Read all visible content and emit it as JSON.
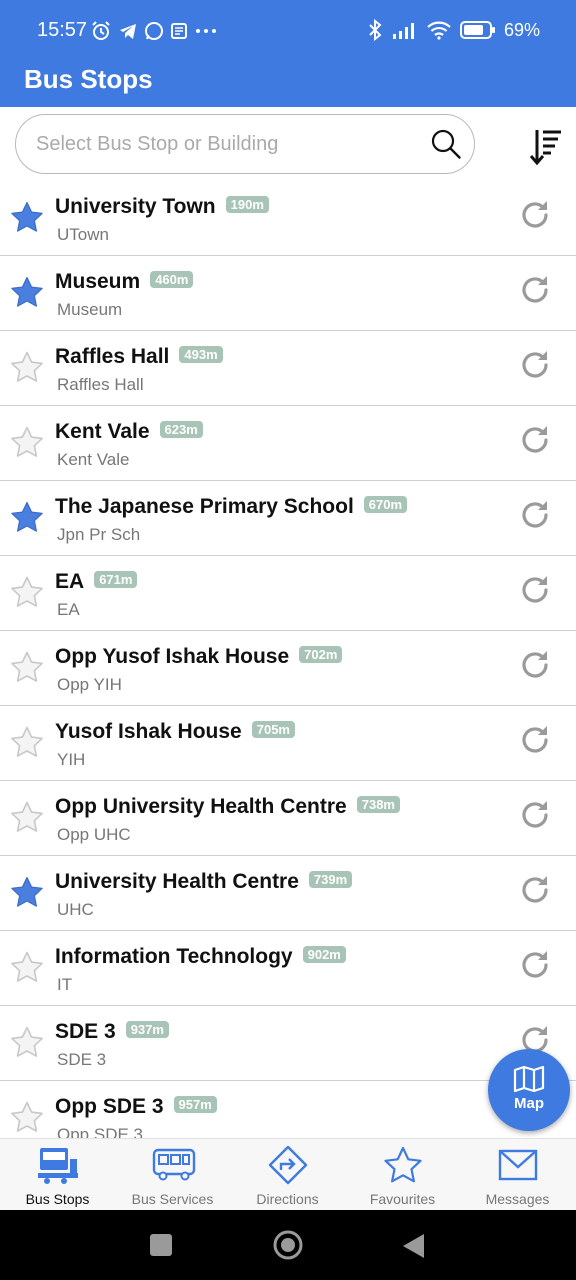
{
  "status_bar": {
    "time": "15:57",
    "battery": "69%"
  },
  "header": {
    "title": "Bus Stops"
  },
  "search": {
    "placeholder": "Select Bus Stop or Building"
  },
  "stops": [
    {
      "name": "University Town",
      "distance": "190m",
      "code": "UTown",
      "favourite": true
    },
    {
      "name": "Museum",
      "distance": "460m",
      "code": "Museum",
      "favourite": true
    },
    {
      "name": "Raffles Hall",
      "distance": "493m",
      "code": "Raffles Hall",
      "favourite": false
    },
    {
      "name": "Kent Vale",
      "distance": "623m",
      "code": "Kent Vale",
      "favourite": false
    },
    {
      "name": "The Japanese Primary School",
      "distance": "670m",
      "code": "Jpn Pr Sch",
      "favourite": true
    },
    {
      "name": "EA",
      "distance": "671m",
      "code": "EA",
      "favourite": false
    },
    {
      "name": "Opp Yusof Ishak House",
      "distance": "702m",
      "code": "Opp YIH",
      "favourite": false
    },
    {
      "name": "Yusof Ishak House",
      "distance": "705m",
      "code": "YIH",
      "favourite": false
    },
    {
      "name": "Opp University Health Centre",
      "distance": "738m",
      "code": "Opp UHC",
      "favourite": false
    },
    {
      "name": "University Health Centre",
      "distance": "739m",
      "code": "UHC",
      "favourite": true
    },
    {
      "name": "Information Technology",
      "distance": "902m",
      "code": "IT",
      "favourite": false
    },
    {
      "name": "SDE 3",
      "distance": "937m",
      "code": "SDE 3",
      "favourite": false
    },
    {
      "name": "Opp SDE 3",
      "distance": "957m",
      "code": "Opp SDE 3",
      "favourite": false
    }
  ],
  "fab": {
    "label": "Map"
  },
  "bottom_nav": [
    {
      "label": "Bus Stops",
      "icon": "bus-stop-icon",
      "active": true
    },
    {
      "label": "Bus Services",
      "icon": "bus-icon",
      "active": false
    },
    {
      "label": "Directions",
      "icon": "directions-icon",
      "active": false
    },
    {
      "label": "Favourites",
      "icon": "star-icon",
      "active": false
    },
    {
      "label": "Messages",
      "icon": "mail-icon",
      "active": false
    }
  ],
  "colors": {
    "primary": "#3f7ae0",
    "star_filled": "#4a7fe0",
    "badge": "#a8c4b7"
  }
}
